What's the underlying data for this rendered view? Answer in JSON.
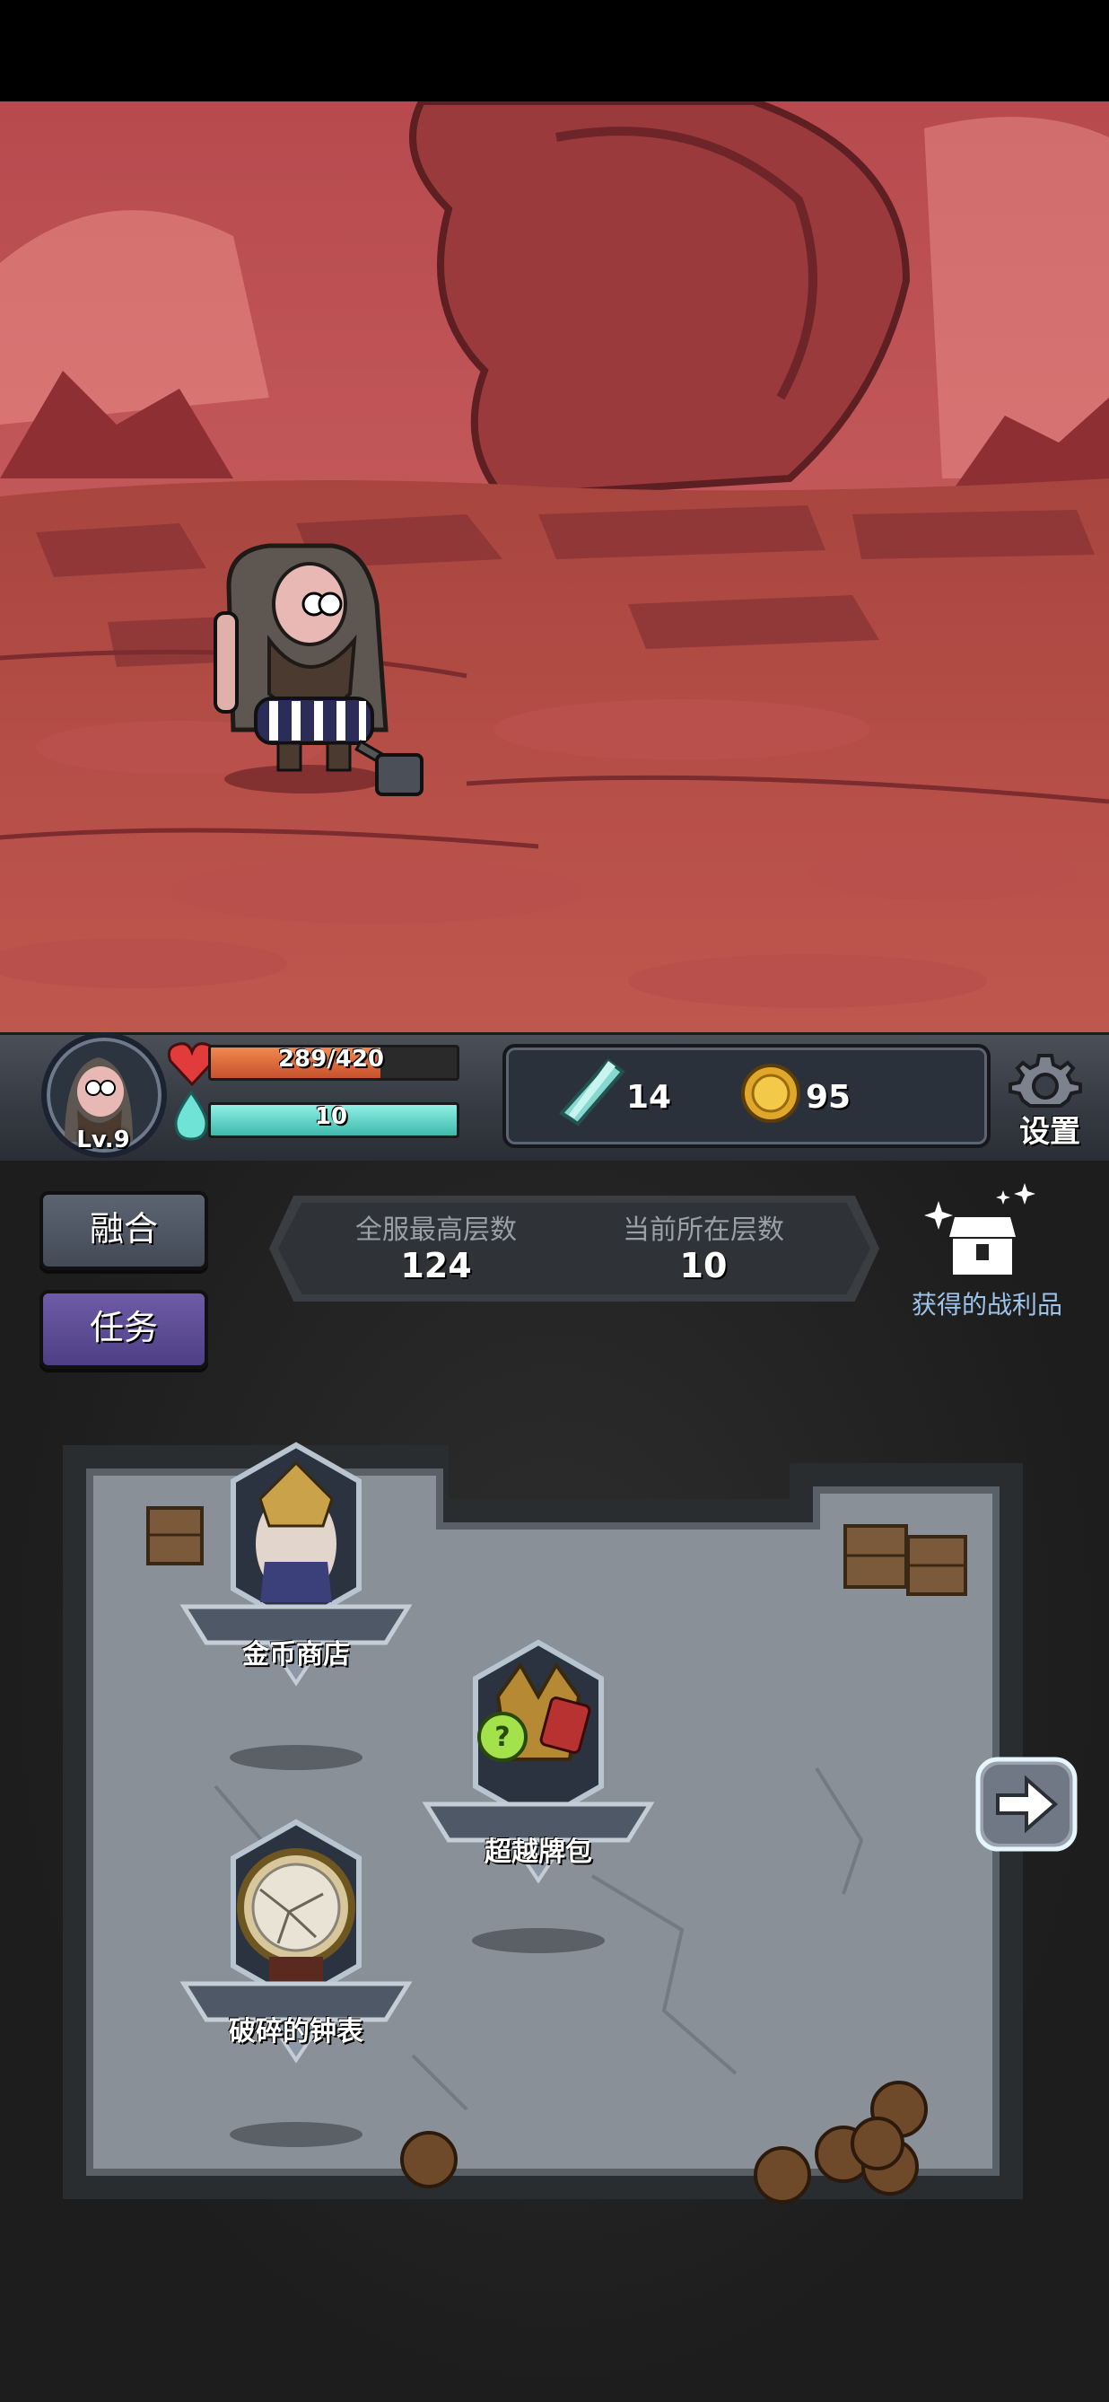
{
  "player": {
    "level": "Lv.9",
    "hp": "289/420",
    "hp_fraction": 0.688,
    "mana": "10",
    "mana_fraction": 1.0
  },
  "resources": {
    "crystals": "14",
    "coins": "95"
  },
  "settings_label": "设置",
  "buttons": {
    "fusion": "融合",
    "quest": "任务"
  },
  "floors": {
    "server_best_label": "全服最高层数",
    "server_best_value": "124",
    "current_label": "当前所在层数",
    "current_value": "10"
  },
  "loot_label": "获得的战利品",
  "map_nodes": [
    {
      "label": "金币商店"
    },
    {
      "label": "超越牌包"
    },
    {
      "label": "破碎的钟表"
    }
  ],
  "colors": {
    "hp_fill": "#d9633a",
    "mana_fill": "#5fd0c6",
    "fusion_button": "#4e5562",
    "quest_button": "#5a4a8e",
    "loot_text": "#9ec3e8"
  }
}
